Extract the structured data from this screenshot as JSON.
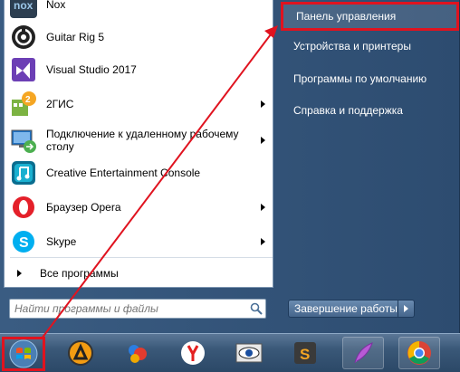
{
  "start_menu": {
    "programs": [
      {
        "label": "Nox",
        "has_submenu": false,
        "icon": "nox-icon"
      },
      {
        "label": "Guitar Rig 5",
        "has_submenu": false,
        "icon": "guitar-rig-icon"
      },
      {
        "label": "Visual Studio 2017",
        "has_submenu": false,
        "icon": "visual-studio-icon"
      },
      {
        "label": "2ГИС",
        "has_submenu": true,
        "icon": "2gis-icon"
      },
      {
        "label": "Подключение к удаленному рабочему столу",
        "has_submenu": true,
        "icon": "remote-desktop-icon"
      },
      {
        "label": "Creative Entertainment Console",
        "has_submenu": false,
        "icon": "creative-console-icon"
      },
      {
        "label": "Браузер Opera",
        "has_submenu": true,
        "icon": "opera-icon"
      },
      {
        "label": "Skype",
        "has_submenu": true,
        "icon": "skype-icon"
      }
    ],
    "all_programs_label": "Все программы",
    "search_placeholder": "Найти программы и файлы",
    "right_links": [
      {
        "label": "Панель управления",
        "highlighted": true
      },
      {
        "label": "Устройства и принтеры",
        "highlighted": false
      },
      {
        "label": "Программы по умолчанию",
        "highlighted": false
      },
      {
        "label": "Справка и поддержка",
        "highlighted": false
      }
    ],
    "shutdown_label": "Завершение работы"
  },
  "taskbar": {
    "apps": [
      "aimp-icon",
      "paint-icon",
      "yandex-browser-icon",
      "eye-app-icon",
      "sublime-text-icon",
      "feather-icon",
      "chrome-icon"
    ]
  },
  "colors": {
    "highlight_red": "#e0131f",
    "menu_blue": "#2d4c70"
  }
}
